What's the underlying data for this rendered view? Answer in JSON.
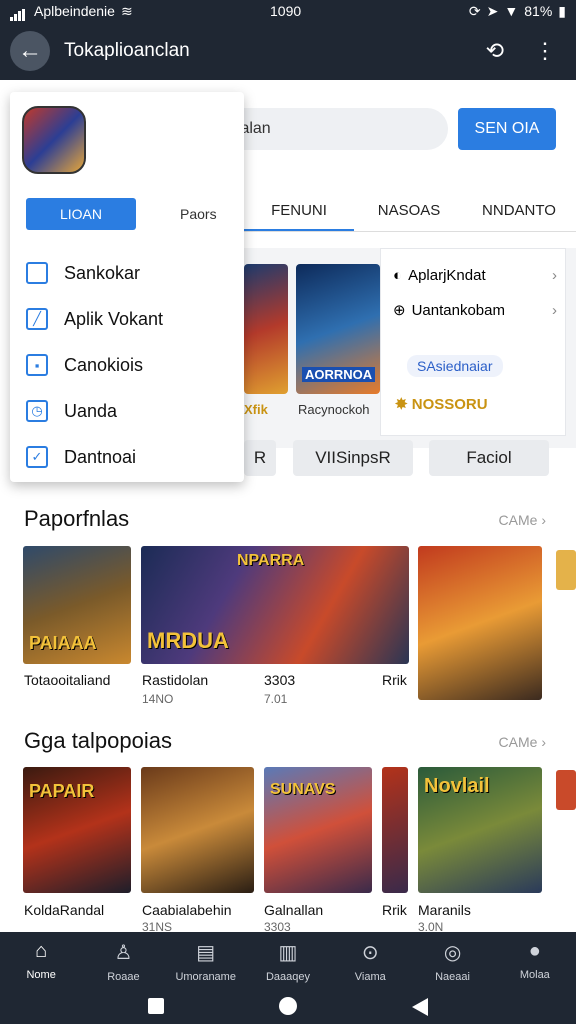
{
  "status": {
    "carrier": "Aplbeindenie",
    "time": "1090",
    "battery": "81%"
  },
  "appbar": {
    "title": "Tokaplioanclan"
  },
  "search": {
    "placeholder": "Kupltk Manalan",
    "button": "SEN OIA"
  },
  "tabs": [
    "FENUNI",
    "NASOAS",
    "NNDANTO"
  ],
  "banners": [
    {
      "label": "Xfik"
    },
    {
      "label": "Racynockoh"
    }
  ],
  "banner_text": "AORRNOA",
  "info": {
    "row1": "AplarjKndat",
    "row2": "Uantankobam",
    "badge": "SAsiednaiar",
    "gold": "NOSSORU"
  },
  "pills": [
    "R",
    "VIISinpsR",
    "Faciol"
  ],
  "drawer": {
    "button": "LIOAN",
    "link": "Paors",
    "items": [
      "Sankokar",
      "Aplik Vokant",
      "Canokiois",
      "Uanda",
      "Dantnoai"
    ]
  },
  "section1": {
    "title": "Paporfnlas",
    "more": "CAMe",
    "cards": [
      {
        "art": "PAIAAA",
        "title": "Totaooitaliand",
        "sub": ""
      },
      {
        "art": "MRDUA",
        "art2": "NPARRA",
        "title": "Rastidolan",
        "sub": "14NO"
      },
      {
        "art": "",
        "title": "3303",
        "sub": "7.01"
      },
      {
        "art": "",
        "title": "Rrik",
        "sub": ""
      }
    ]
  },
  "section2": {
    "title": "Gga talpopoias",
    "more": "CAMe",
    "cards": [
      {
        "art": "PAPAIR",
        "title": "KoldaRandal",
        "sub": ""
      },
      {
        "art": "",
        "title": "Caabialabehin",
        "sub": "31NS"
      },
      {
        "art": "SUNAVS",
        "title": "Galnallan",
        "sub": "3303"
      },
      {
        "art": "",
        "title": "Rrik",
        "sub": ""
      },
      {
        "art": "Novlail",
        "title": "Maranils",
        "sub": "3.0N"
      }
    ]
  },
  "nav": [
    "Nome",
    "Roaae",
    "Umoraname",
    "Daaaqey",
    "Viama",
    "Naeaai",
    "Molaa"
  ],
  "colors": {
    "accent": "#2b7de1",
    "dark": "#1f2733"
  }
}
